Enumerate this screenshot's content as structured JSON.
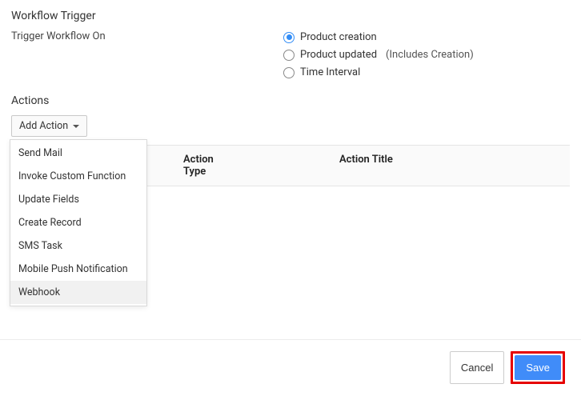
{
  "sections": {
    "trigger_heading": "Workflow Trigger",
    "actions_heading": "Actions"
  },
  "trigger": {
    "label": "Trigger Workflow On",
    "options": {
      "creation": "Product creation",
      "updated": "Product updated",
      "updated_extra": "(Includes Creation)",
      "interval": "Time Interval"
    }
  },
  "add_action": {
    "label": "Add Action",
    "menu": {
      "send_mail": "Send Mail",
      "invoke_fn": "Invoke Custom Function",
      "update_fields": "Update Fields",
      "create_record": "Create Record",
      "sms_task": "SMS Task",
      "mobile_push": "Mobile Push Notification",
      "webhook": "Webhook"
    }
  },
  "table": {
    "action_type": "Action Type",
    "action_title": "Action Title"
  },
  "footer": {
    "cancel": "Cancel",
    "save": "Save"
  }
}
